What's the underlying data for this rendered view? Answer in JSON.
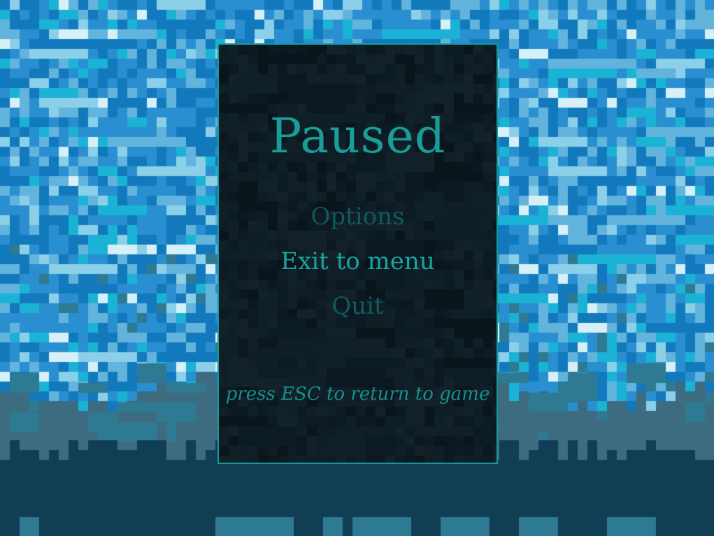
{
  "pause_menu": {
    "title": "Paused",
    "items": [
      {
        "label": "Options",
        "state": "dimmed"
      },
      {
        "label": "Exit to menu",
        "state": "highlighted"
      },
      {
        "label": "Quit",
        "state": "dimmed"
      }
    ],
    "hint": "press ESC to return to game"
  },
  "colors": {
    "panel_border": "#16999a",
    "accent_text": "#1aa39f",
    "dimmed_text": "#0f5a5c",
    "sky_palette": [
      "#1279bd",
      "#2a8fd0",
      "#63b4dc",
      "#8ccfe8",
      "#1ab3d6",
      "#d6f0f8",
      "#4a92b5",
      "#2e7a92",
      "#3d6c80"
    ],
    "ground_color": "#113d55"
  }
}
